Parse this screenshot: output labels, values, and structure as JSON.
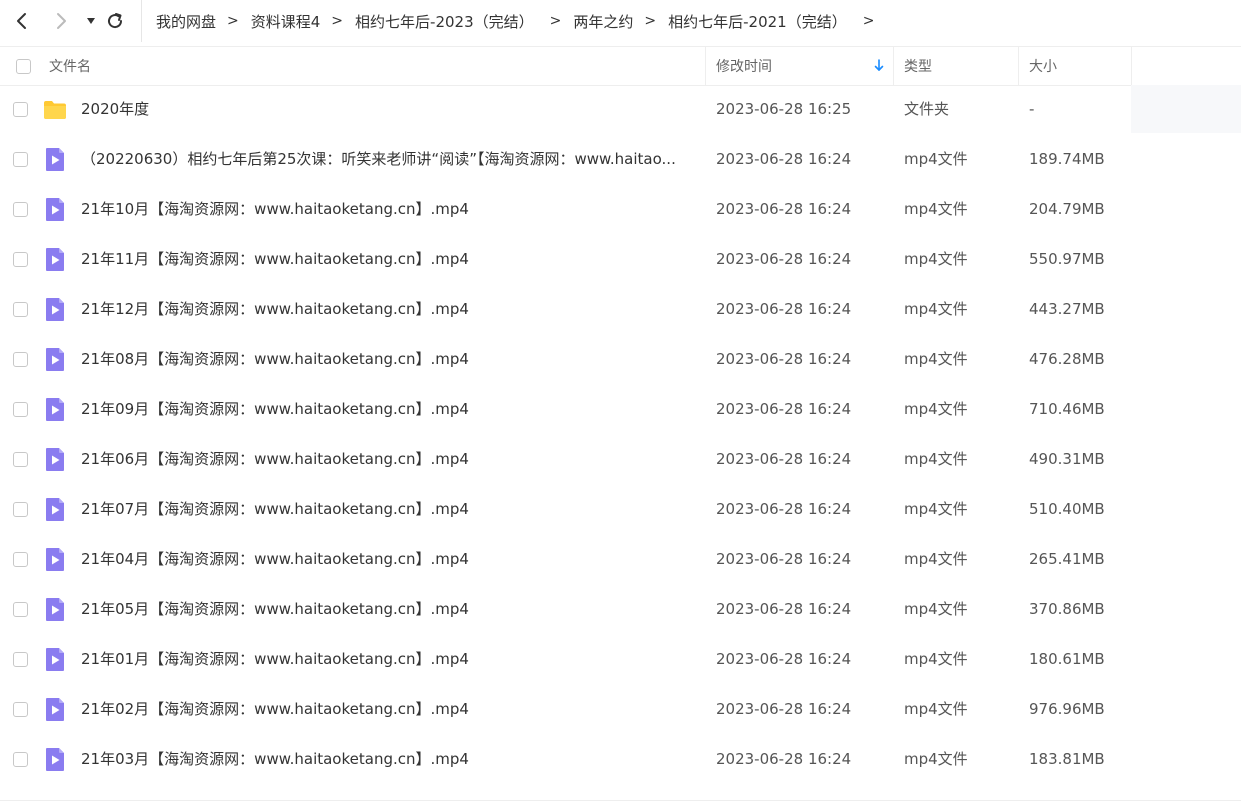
{
  "toolbar": {
    "back_icon": "chevron-left-icon",
    "forward_icon": "chevron-right-icon",
    "history_icon": "caret-down-icon",
    "refresh_icon": "refresh-icon"
  },
  "breadcrumb": {
    "items": [
      "我的网盘",
      "资料课程4",
      "相约七年后-2023（完结）",
      "两年之约",
      "相约七年后-2021（完结）"
    ],
    "separator": ">"
  },
  "columns": {
    "name": "文件名",
    "modified": "修改时间",
    "type": "类型",
    "size": "大小",
    "sort_icon": "arrow-down-icon"
  },
  "colors": {
    "folder": "#FFC933",
    "video": "#8A7CF0",
    "sort_arrow": "#1a8cff"
  },
  "files": [
    {
      "name": "2020年度",
      "time": "2023-06-28 16:25",
      "type": "文件夹",
      "size": "-",
      "icon": "folder-icon"
    },
    {
      "name": "（20220630）相约七年后第25次课：听笑来老师讲“阅读”【海淘资源网：www.haitao...",
      "time": "2023-06-28 16:24",
      "type": "mp4文件",
      "size": "189.74MB",
      "icon": "video-file-icon"
    },
    {
      "name": "21年10月【海淘资源网：www.haitaoketang.cn】.mp4",
      "time": "2023-06-28 16:24",
      "type": "mp4文件",
      "size": "204.79MB",
      "icon": "video-file-icon"
    },
    {
      "name": "21年11月【海淘资源网：www.haitaoketang.cn】.mp4",
      "time": "2023-06-28 16:24",
      "type": "mp4文件",
      "size": "550.97MB",
      "icon": "video-file-icon"
    },
    {
      "name": "21年12月【海淘资源网：www.haitaoketang.cn】.mp4",
      "time": "2023-06-28 16:24",
      "type": "mp4文件",
      "size": "443.27MB",
      "icon": "video-file-icon"
    },
    {
      "name": "21年08月【海淘资源网：www.haitaoketang.cn】.mp4",
      "time": "2023-06-28 16:24",
      "type": "mp4文件",
      "size": "476.28MB",
      "icon": "video-file-icon"
    },
    {
      "name": "21年09月【海淘资源网：www.haitaoketang.cn】.mp4",
      "time": "2023-06-28 16:24",
      "type": "mp4文件",
      "size": "710.46MB",
      "icon": "video-file-icon"
    },
    {
      "name": "21年06月【海淘资源网：www.haitaoketang.cn】.mp4",
      "time": "2023-06-28 16:24",
      "type": "mp4文件",
      "size": "490.31MB",
      "icon": "video-file-icon"
    },
    {
      "name": "21年07月【海淘资源网：www.haitaoketang.cn】.mp4",
      "time": "2023-06-28 16:24",
      "type": "mp4文件",
      "size": "510.40MB",
      "icon": "video-file-icon"
    },
    {
      "name": "21年04月【海淘资源网：www.haitaoketang.cn】.mp4",
      "time": "2023-06-28 16:24",
      "type": "mp4文件",
      "size": "265.41MB",
      "icon": "video-file-icon"
    },
    {
      "name": "21年05月【海淘资源网：www.haitaoketang.cn】.mp4",
      "time": "2023-06-28 16:24",
      "type": "mp4文件",
      "size": "370.86MB",
      "icon": "video-file-icon"
    },
    {
      "name": "21年01月【海淘资源网：www.haitaoketang.cn】.mp4",
      "time": "2023-06-28 16:24",
      "type": "mp4文件",
      "size": "180.61MB",
      "icon": "video-file-icon"
    },
    {
      "name": "21年02月【海淘资源网：www.haitaoketang.cn】.mp4",
      "time": "2023-06-28 16:24",
      "type": "mp4文件",
      "size": "976.96MB",
      "icon": "video-file-icon"
    },
    {
      "name": "21年03月【海淘资源网：www.haitaoketang.cn】.mp4",
      "time": "2023-06-28 16:24",
      "type": "mp4文件",
      "size": "183.81MB",
      "icon": "video-file-icon"
    }
  ]
}
